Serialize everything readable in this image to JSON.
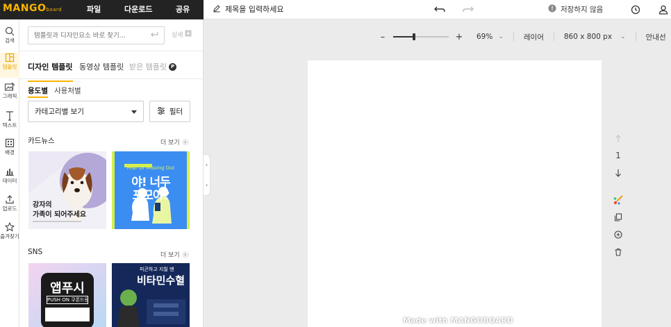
{
  "brand": {
    "logo": "MANGO",
    "logo_sub": "board",
    "accent": "#f7b500"
  },
  "topbar": {
    "menu": [
      "파일",
      "다운로드",
      "공유"
    ],
    "title_placeholder": "제목을 입력하세요",
    "save_status": "저장하지 않음"
  },
  "rail": {
    "items": [
      {
        "label": "검색",
        "icon": "search-icon"
      },
      {
        "label": "템플릿",
        "icon": "template-icon"
      },
      {
        "label": "그래픽",
        "icon": "graphic-icon"
      },
      {
        "label": "텍스트",
        "icon": "text-icon"
      },
      {
        "label": "배경",
        "icon": "background-icon"
      },
      {
        "label": "데이터",
        "icon": "chart-icon"
      },
      {
        "label": "업로드",
        "icon": "upload-icon"
      },
      {
        "label": "즐겨찾기",
        "icon": "star-icon"
      }
    ]
  },
  "panel": {
    "search_placeholder": "템플릿과 디자인요소 바로 찾기...",
    "detail_label": "상세",
    "tabs": [
      "디자인 템플릿",
      "동영상 템플릿",
      "받은 템플릿"
    ],
    "premium_badge": "P",
    "subtabs": [
      "용도별",
      "사용처별"
    ],
    "category_select": "카테고리별 보기",
    "filter_label": "필터",
    "sections": [
      {
        "title": "카드뉴스",
        "more": "더 보기",
        "cards": [
          {
            "headline_1": "강자의",
            "headline_2": "가족이 되어주세요"
          },
          {
            "headline_1": "야! 너두",
            "headline_2": "포모야?",
            "top_tag": "Fear Of Missing Out"
          }
        ]
      },
      {
        "title": "SNS",
        "more": "더 보기",
        "cards": [
          {
            "headline_1": "앱푸시",
            "headline_2": "PUSH ON 쿠폰드림"
          },
          {
            "headline_1": "비타민수혈",
            "top_tag": "피곤하고 지칠 땐"
          }
        ]
      }
    ]
  },
  "canvas": {
    "zoom": "69%",
    "zoom_value": 0.38,
    "layer_label": "레이어",
    "size_label": "860 x 800 px",
    "guide_label": "안내선",
    "page_number": "1",
    "watermark": "Made with MANGOBOARD"
  }
}
